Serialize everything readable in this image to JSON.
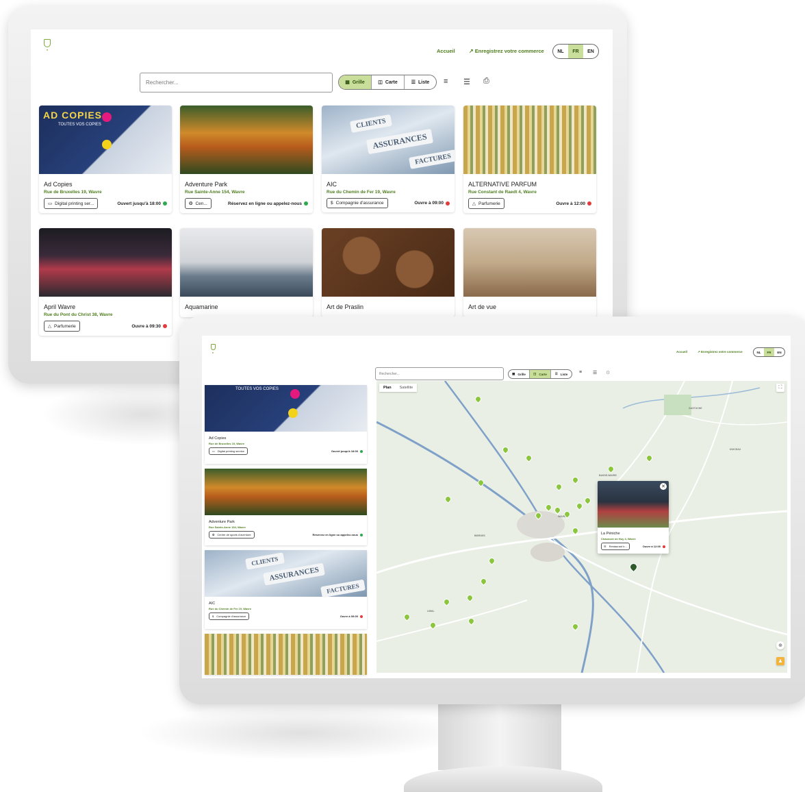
{
  "header": {
    "home": "Accueil",
    "register": "Enregistrez votre commerce",
    "langs": [
      "NL",
      "FR",
      "EN"
    ],
    "active_lang": "FR"
  },
  "search": {
    "placeholder_main": "Rechercher...",
    "placeholder_small": "Rechercher..."
  },
  "views": {
    "grid": "Grille",
    "map": "Carte",
    "list": "Liste"
  },
  "icons": {
    "filter": "filter-icon",
    "sort": "sort-icon",
    "print": "print-icon",
    "grid": "grid-icon",
    "map": "map-icon",
    "list": "list-icon",
    "external": "external-link-icon"
  },
  "colors": {
    "accent": "#4e7d1e",
    "active_bg": "#c9de9a",
    "open": "#2fa84f",
    "closed": "#e23b3b"
  },
  "businesses": [
    {
      "name": "Ad Copies",
      "address": "Rue de Bruxelles 19, Wavre",
      "category": "Digital printing ser...",
      "status": "Ouvert jusqu'à 18:00",
      "status_color": "green",
      "icon": "laptop-icon"
    },
    {
      "name": "Adventure Park",
      "address": "Rue Sainte-Anne 154, Wavre",
      "category": "Cen...",
      "status": "Réservez en ligne ou appelez-nous",
      "status_color": "green",
      "icon": "compass-icon"
    },
    {
      "name": "AIC",
      "address": "Rue du Chemin de Fer 19, Wavre",
      "category": "Compagnie d'assurance",
      "status": "Ouvre à 09:00",
      "status_color": "red",
      "icon": "dollar-icon"
    },
    {
      "name": "ALTERNATIVE PARFUM",
      "address": "Rue Constant de Raedt 4, Wavre",
      "category": "Parfumerie",
      "status": "Ouvre à 12:00",
      "status_color": "red",
      "icon": "perfume-icon"
    },
    {
      "name": "April Wavre",
      "address": "Rue du Pont du Christ 38, Wavre",
      "category": "Parfumerie",
      "status": "Ouvre à 09:30",
      "status_color": "red",
      "icon": "perfume-icon"
    },
    {
      "name": "Aquamarine",
      "address": "",
      "category": "",
      "status": "",
      "status_color": ""
    },
    {
      "name": "Art de Praslin",
      "address": "",
      "category": "",
      "status": "",
      "status_color": ""
    },
    {
      "name": "Art de vue",
      "address": "",
      "category": "",
      "status": "",
      "status_color": ""
    }
  ],
  "image_text": {
    "adcopies_title": "AD COPIES",
    "adcopies_sub": "TOUTES VOS COPIES",
    "aic_keys": [
      "CLIENTS",
      "ASSURANCES",
      "FACTURES"
    ]
  },
  "list_view": [
    {
      "name": "Ad Copies",
      "address": "Rue de Bruxelles 19, Wavre",
      "category": "Digital printing service",
      "status": "Ouvert jusqu'à 18:00",
      "status_color": "green"
    },
    {
      "name": "Adventure Park",
      "address": "Rue Sainte-Anne 154, Wavre",
      "category": "Centre de sports d'aventure",
      "status": "Réservez en ligne ou appelez-nous",
      "status_color": "green"
    },
    {
      "name": "AIC",
      "address": "Rue du Chemin de Fer 19, Wavre",
      "category": "Compagnie d'assurance",
      "status": "Ouvre à 09:00",
      "status_color": "red"
    }
  ],
  "map": {
    "tabs": [
      "Plan",
      "Satellite"
    ],
    "active_tab": "Plan",
    "places": [
      "WAVRE",
      "BASSE-WAVRE",
      "LIMAL",
      "DOICEAU",
      "GASTUCHE",
      "BIERGES"
    ],
    "popup": {
      "name": "La Péniche",
      "address": "Chaussée de Huy 4, Wavre",
      "category": "Restaurant b...",
      "status": "Ouvre à 12:00",
      "status_color": "red"
    }
  }
}
